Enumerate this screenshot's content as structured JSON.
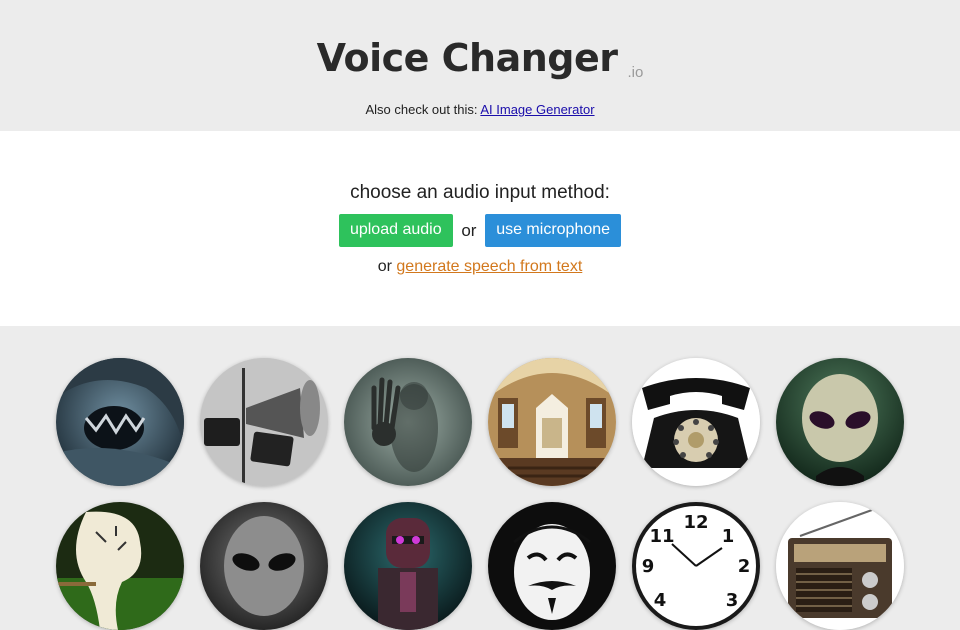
{
  "header": {
    "title": "Voice Changer",
    "title_suffix": ".io",
    "also_prefix": "Also check out this:",
    "also_link": "AI Image Generator"
  },
  "input_panel": {
    "prompt": "choose an audio input method:",
    "upload_label": "upload audio",
    "or_1": "or",
    "microphone_label": "use microphone",
    "or_2": "or",
    "tts_link": "generate speech from text"
  },
  "voices": [
    {
      "icon": "cave-monster-icon"
    },
    {
      "icon": "megaphone-icon"
    },
    {
      "icon": "ghost-hand-icon"
    },
    {
      "icon": "cathedral-icon"
    },
    {
      "icon": "rotary-telephone-icon"
    },
    {
      "icon": "alien-icon"
    },
    {
      "icon": "melting-clock-icon"
    },
    {
      "icon": "grey-alien-icon"
    },
    {
      "icon": "robot-icon"
    },
    {
      "icon": "anonymous-mask-icon"
    },
    {
      "icon": "clock-icon"
    },
    {
      "icon": "radio-icon"
    }
  ]
}
